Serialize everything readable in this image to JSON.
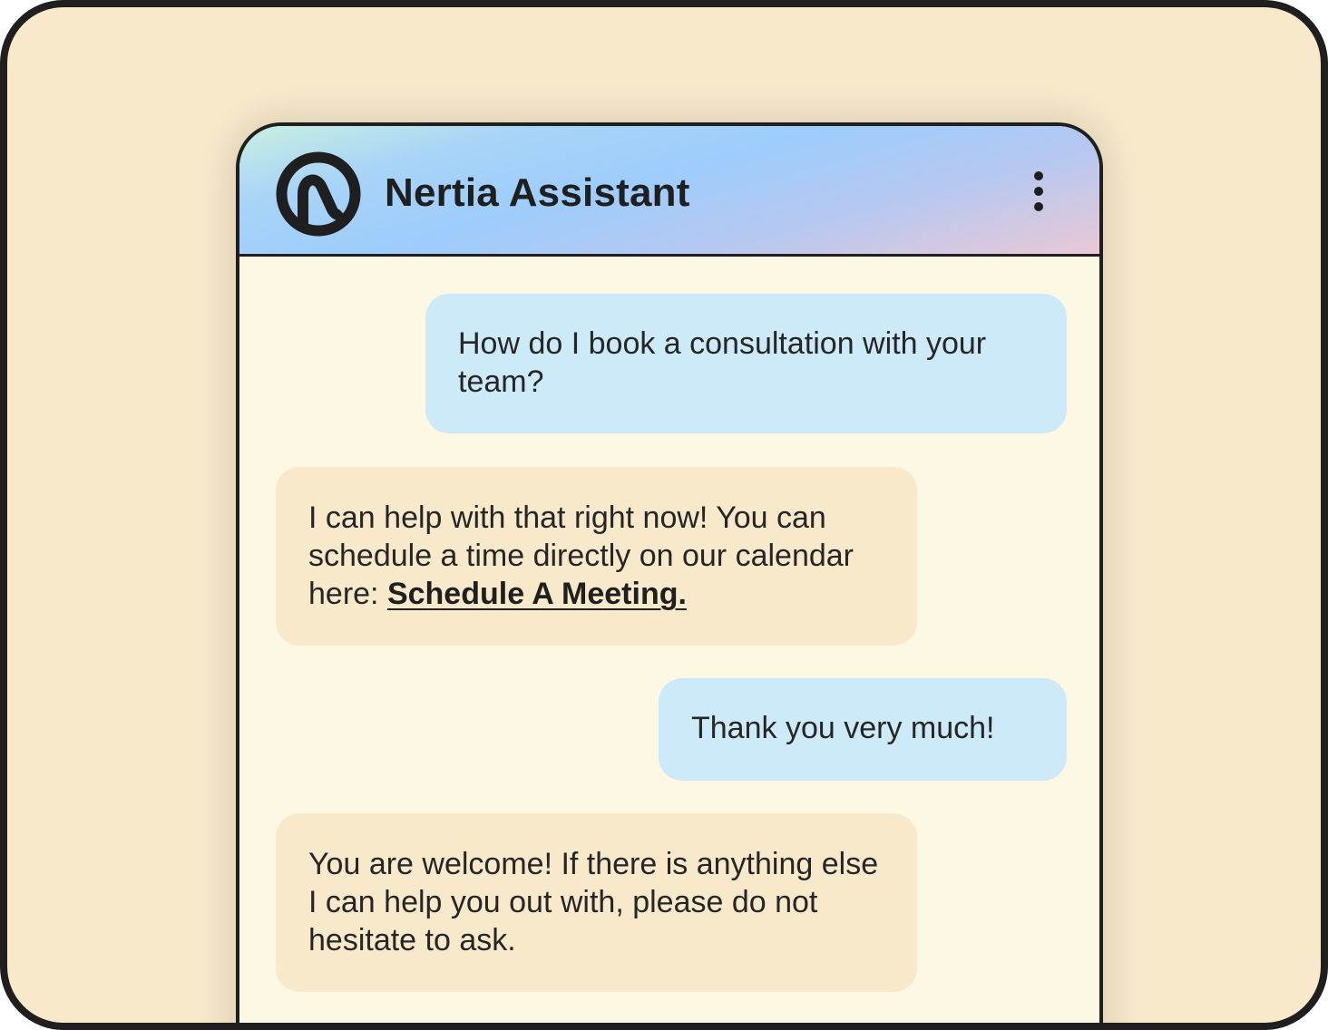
{
  "header": {
    "title": "Nertia Assistant",
    "logo_icon": "nertia-logo-icon",
    "menu_icon": "more-vertical-icon"
  },
  "messages": [
    {
      "sender": "user",
      "text": "How do I book a consultation with your team?"
    },
    {
      "sender": "bot",
      "text": "I can help with that right now! You can schedule a time directly on our calendar here: ",
      "link": "Schedule A Meeting."
    },
    {
      "sender": "user",
      "text": "Thank you very much!"
    },
    {
      "sender": "bot",
      "text": "You are welcome! If there is anything else I can help you out with, please do not hesitate to ask."
    }
  ],
  "colors": {
    "background": "#f8e9cb",
    "chat_background": "#fdf8e3",
    "user_bubble": "#cdeaf8",
    "bot_bubble": "#f8e9cb",
    "text": "#262626",
    "border": "#1f1f1f"
  }
}
